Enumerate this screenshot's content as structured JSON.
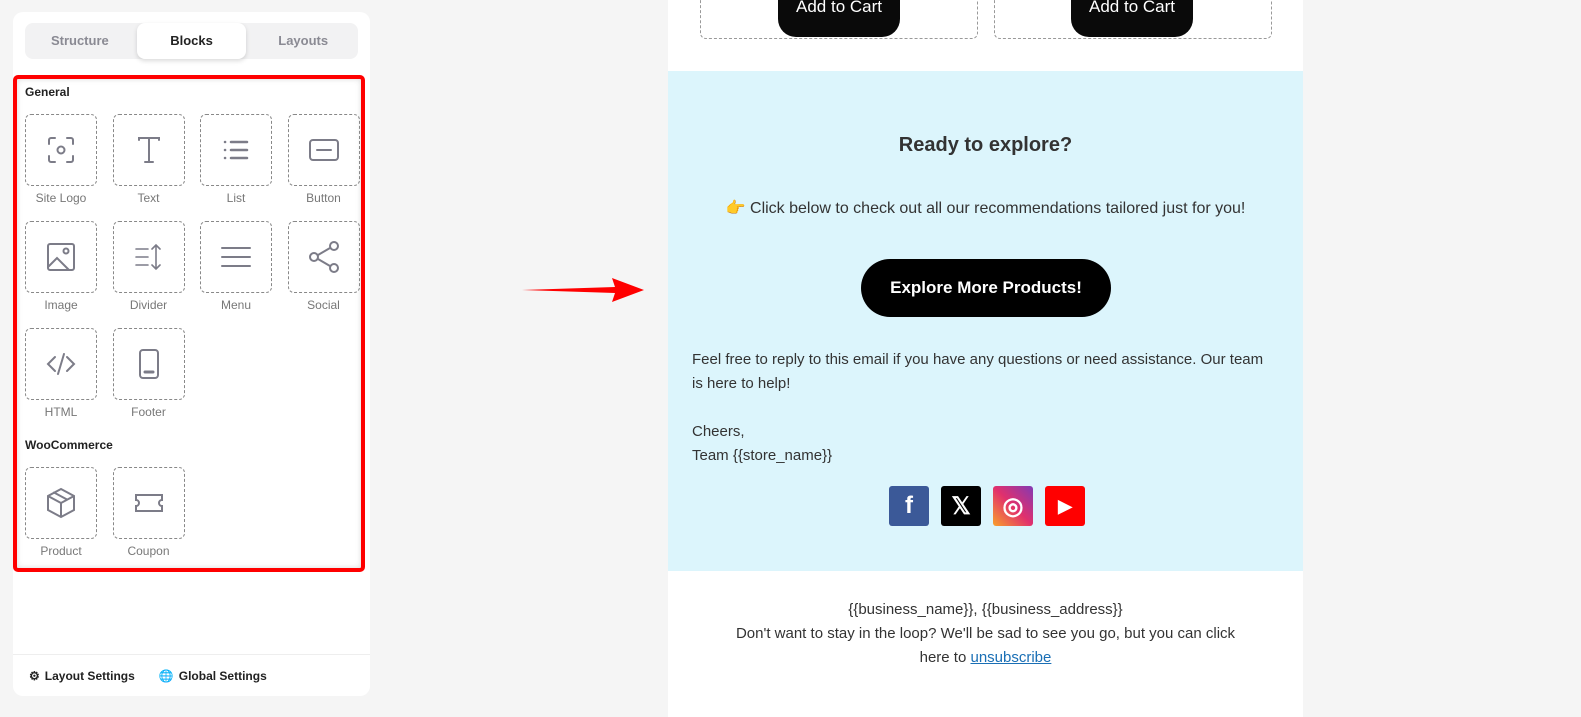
{
  "tabs": [
    "Structure",
    "Blocks",
    "Layouts"
  ],
  "active_tab": "Blocks",
  "sections": {
    "general": "General",
    "woo": "WooCommerce"
  },
  "general_blocks": [
    {
      "label": "Site Logo",
      "icon": "site-logo-icon"
    },
    {
      "label": "Text",
      "icon": "text-icon"
    },
    {
      "label": "List",
      "icon": "list-icon"
    },
    {
      "label": "Button",
      "icon": "button-icon"
    },
    {
      "label": "Image",
      "icon": "image-icon"
    },
    {
      "label": "Divider",
      "icon": "divider-icon"
    },
    {
      "label": "Menu",
      "icon": "menu-icon"
    },
    {
      "label": "Social",
      "icon": "share-icon"
    },
    {
      "label": "HTML",
      "icon": "code-icon"
    },
    {
      "label": "Footer",
      "icon": "footer-icon"
    }
  ],
  "woo_blocks": [
    {
      "label": "Product",
      "icon": "box-icon"
    },
    {
      "label": "Coupon",
      "icon": "ticket-icon"
    }
  ],
  "footer": {
    "layout": "Layout Settings",
    "global": "Global Settings"
  },
  "email": {
    "add_to_cart": "Add to Cart",
    "heading": "Ready to explore?",
    "emoji": "👉",
    "subtext": "Click below to check out all our recommendations tailored just for you!",
    "cta": "Explore More Products!",
    "para": "Feel free to reply to this email if you have any questions or need assistance. Our team is here to help!",
    "cheers": "Cheers,",
    "team": "Team {{store_name}}",
    "social": [
      "f",
      "𝕏",
      "◎",
      "▶"
    ],
    "business": "{{business_name}}, {{business_address}}",
    "unsub_text": "Don't want to stay in the loop? We'll be sad to see you go, but you can click here to",
    "unsub_link": "unsubscribe"
  },
  "colors": {
    "highlight": "#ff0000",
    "email_bg": "#dcf5fc",
    "facebook": "#3b5998",
    "x": "#000000",
    "youtube": "#ff0000"
  }
}
